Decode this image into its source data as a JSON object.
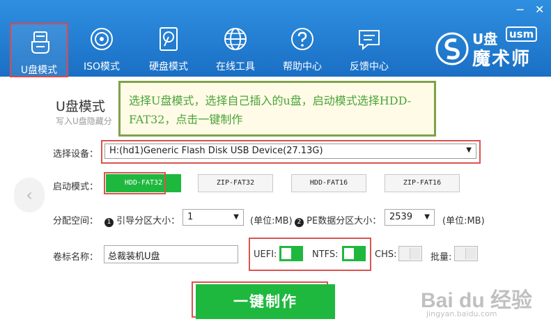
{
  "window": {
    "minimize": "−",
    "close": "✕"
  },
  "nav": [
    {
      "label": "U盘模式",
      "icon": "usb-drive-icon",
      "selected": true
    },
    {
      "label": "ISO模式",
      "icon": "disc-icon"
    },
    {
      "label": "硬盘模式",
      "icon": "hard-disk-icon"
    },
    {
      "label": "在线工具",
      "icon": "globe-icon"
    },
    {
      "label": "帮助中心",
      "icon": "question-icon"
    },
    {
      "label": "反馈中心",
      "icon": "chat-icon"
    }
  ],
  "logo": {
    "line1": "U盘",
    "badge": "usm",
    "line2": "魔术师"
  },
  "page": {
    "title": "U盘模式",
    "subtitle": "写入U盘隐藏分"
  },
  "tooltip": {
    "text": "选择U盘模式，选择自己插入的u盘，启动模式选择HDD-FAT32，点击一键制作"
  },
  "device": {
    "label": "选择设备：",
    "value": "H:(hd1)Generic Flash Disk USB Device(27.13G)"
  },
  "boot": {
    "label": "启动模式：",
    "modes": [
      "HDD-FAT32",
      "ZIP-FAT32",
      "HDD-FAT16",
      "ZIP-FAT16"
    ],
    "selected": "HDD-FAT32"
  },
  "partition": {
    "label": "分配空间：",
    "boot_num": "1",
    "boot_label": "引导分区大小：",
    "boot_value": "1",
    "boot_unit": "(单位:MB)",
    "pe_num": "2",
    "pe_label": "PE数据分区大小：",
    "pe_value": "2539",
    "pe_unit": "(单位:MB)"
  },
  "volume": {
    "label": "卷标名称：",
    "value": "总裁装机U盘"
  },
  "options": {
    "uefi": "UEFI:",
    "ntfs": "NTFS:",
    "chs": "CHS:",
    "batch": "批量:",
    "uefi_on": true,
    "ntfs_on": true,
    "chs_on": false,
    "batch_on": false
  },
  "action": {
    "make": "一键制作"
  },
  "nav_back": "‹",
  "watermark": {
    "brand": "Bai du 经验",
    "url": "jingyan.baidu.com"
  },
  "colors": {
    "header": "#1f7dd6",
    "accent": "#1fb83f",
    "highlight": "#d9534f",
    "tooltip_border": "#7ea14a"
  }
}
